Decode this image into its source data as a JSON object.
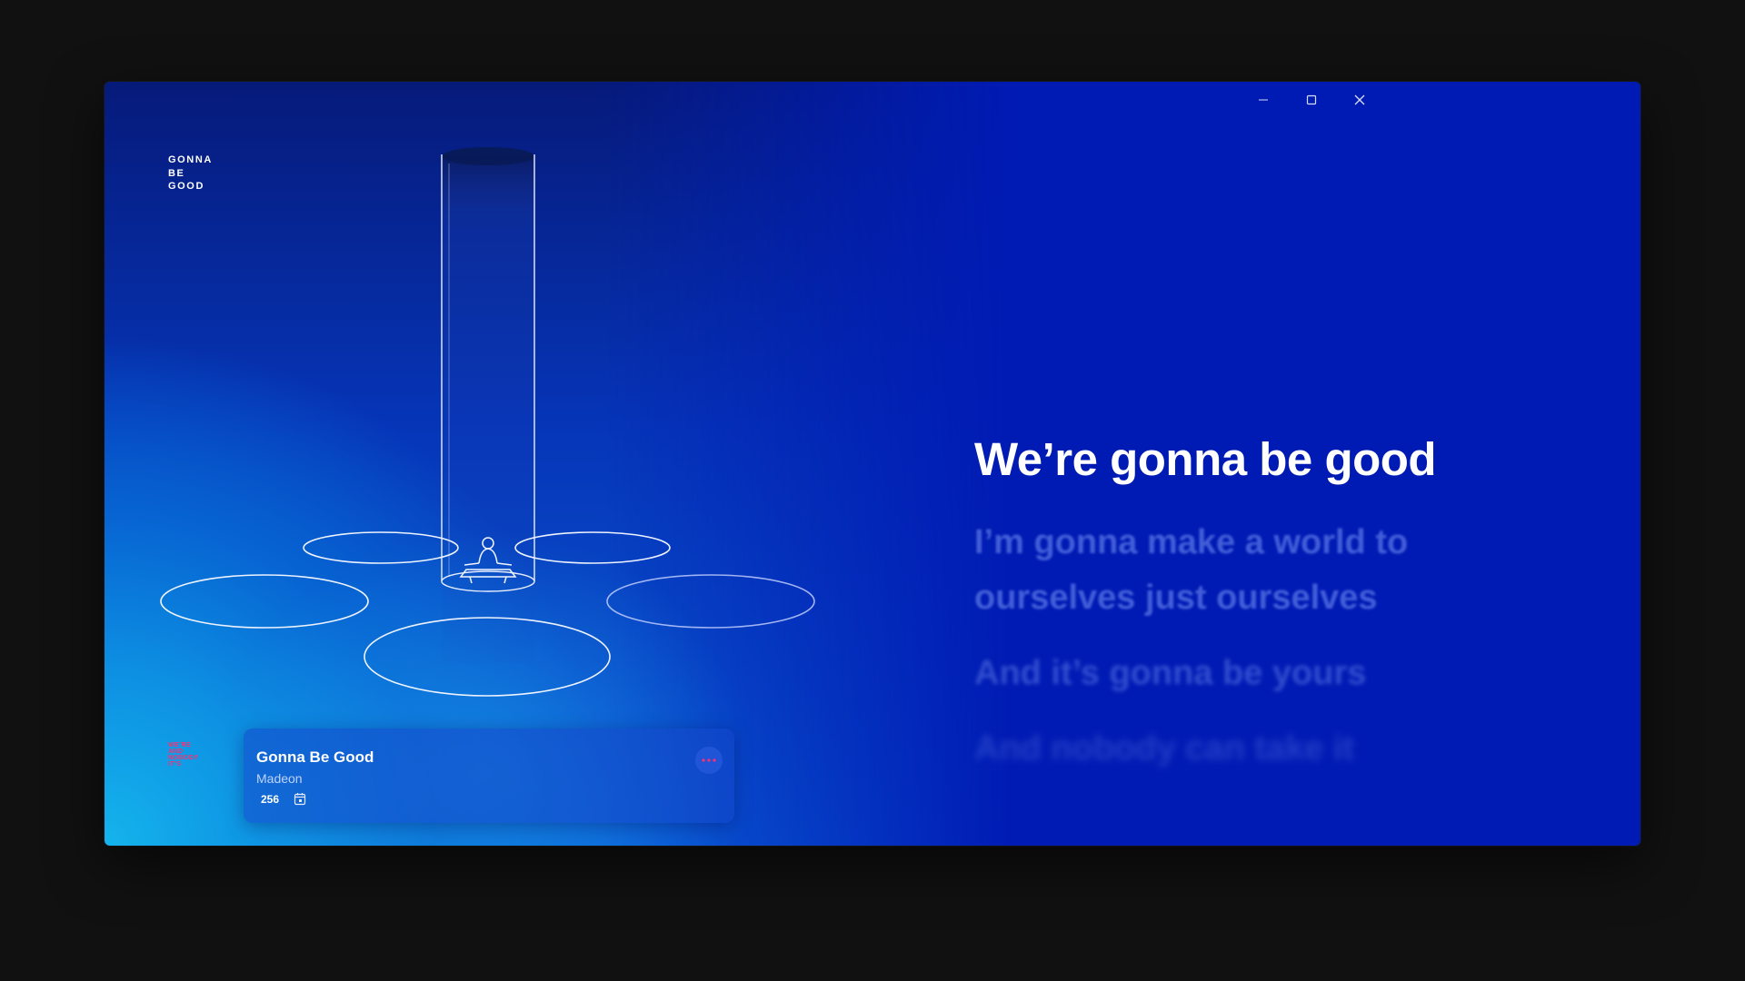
{
  "app": {
    "logo_lines": [
      "GONNA",
      "BE",
      "GOOD"
    ],
    "accent_color": "#ff2d6f",
    "background_color": "#001bb4"
  },
  "window_controls": {
    "minimize_icon": "minimize-icon",
    "maximize_icon": "maximize-icon",
    "close_icon": "close-icon"
  },
  "lyrics": {
    "current": "We’re gonna be good",
    "upcoming": [
      "I’m gonna make a world to ourselves just ourselves",
      "And it’s gonna be yours",
      "And nobody can take it"
    ]
  },
  "now_playing": {
    "title": "Gonna Be Good",
    "artist": "Madeon",
    "count": "256",
    "calendar_icon": "calendar-icon",
    "more_icon": "more-options-icon"
  },
  "tiny_lyrics_left": [
    "WE'RE",
    "AND",
    "NOBODY",
    "IT'S"
  ]
}
